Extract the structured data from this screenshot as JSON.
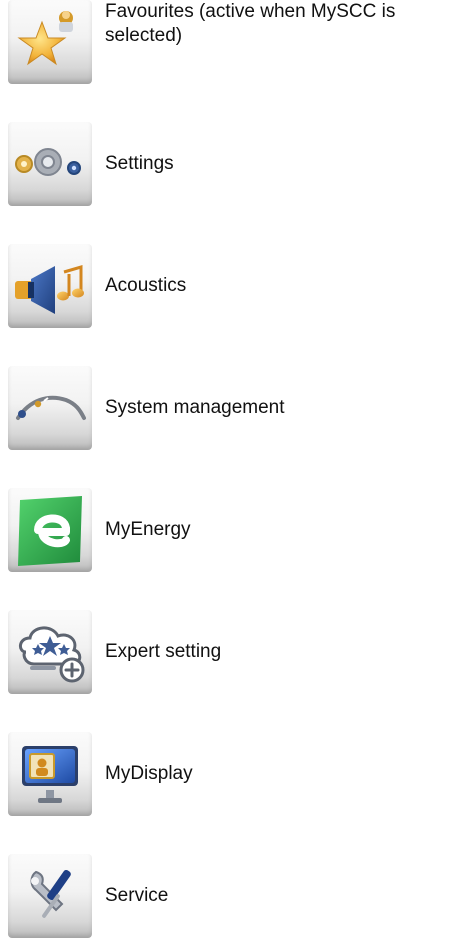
{
  "items": [
    {
      "label": "Favourites (active when MySCC is selected)",
      "icon": "star-user-icon"
    },
    {
      "label": "Settings",
      "icon": "gears-icon"
    },
    {
      "label": "Acoustics",
      "icon": "speaker-music-icon"
    },
    {
      "label": "System management",
      "icon": "system-wand-icon"
    },
    {
      "label": "MyEnergy",
      "icon": "energy-e-icon"
    },
    {
      "label": "Expert setting",
      "icon": "cloud-stars-plus-icon"
    },
    {
      "label": "MyDisplay",
      "icon": "monitor-icon"
    },
    {
      "label": "Service",
      "icon": "tools-icon"
    }
  ],
  "colors": {
    "tile_top": "#f6f6f6",
    "tile_bottom": "#b9b9b9",
    "energy_green": "#2fae4f",
    "star_gold": "#f2b33a",
    "speaker_blue": "#2f59a8",
    "note_gold": "#e7a22b"
  }
}
